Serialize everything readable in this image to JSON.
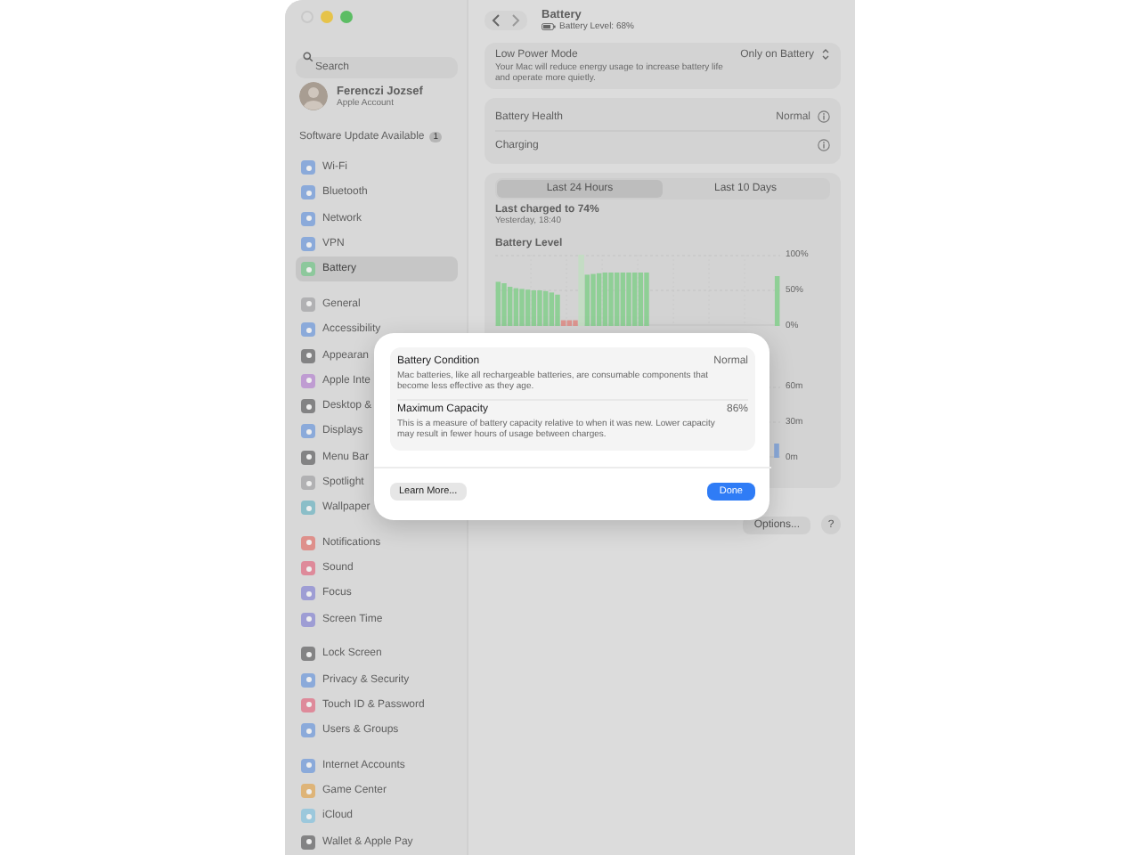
{
  "sidebar": {
    "search": {
      "placeholder": "Search"
    },
    "account": {
      "name": "Ferenczi Jozsef",
      "subtitle": "Apple Account"
    },
    "update": {
      "label": "Software Update Available",
      "badge": "1"
    },
    "groups": [
      {
        "items": [
          {
            "label": "Wi-Fi",
            "color": "#8baada",
            "selected": false
          },
          {
            "label": "Bluetooth",
            "color": "#8baada",
            "selected": false
          },
          {
            "label": "Network",
            "color": "#8baada",
            "selected": false
          },
          {
            "label": "VPN",
            "color": "#8baada",
            "selected": false
          },
          {
            "label": "Battery",
            "color": "#8dc89c",
            "selected": true
          }
        ]
      },
      {
        "items": [
          {
            "label": "General",
            "color": "#b1b1b3",
            "selected": false
          },
          {
            "label": "Accessibility",
            "color": "#8baada",
            "selected": false
          },
          {
            "label": "Appearan",
            "color": "#838384",
            "selected": false
          },
          {
            "label": "Apple Inte",
            "color": "#bf9cd2",
            "selected": false
          },
          {
            "label": "Desktop &",
            "color": "#838384",
            "selected": false
          },
          {
            "label": "Displays",
            "color": "#8baada",
            "selected": false
          },
          {
            "label": "Menu Bar",
            "color": "#838384",
            "selected": false
          },
          {
            "label": "Spotlight",
            "color": "#b1b1b3",
            "selected": false
          },
          {
            "label": "Wallpaper",
            "color": "#8bbec8",
            "selected": false
          }
        ]
      },
      {
        "items": [
          {
            "label": "Notifications",
            "color": "#de908b",
            "selected": false
          },
          {
            "label": "Sound",
            "color": "#de8a9a",
            "selected": false
          },
          {
            "label": "Focus",
            "color": "#9e9dd4",
            "selected": false
          },
          {
            "label": "Screen Time",
            "color": "#9e9dd4",
            "selected": false
          }
        ]
      },
      {
        "items": [
          {
            "label": "Lock Screen",
            "color": "#838384",
            "selected": false
          },
          {
            "label": "Privacy & Security",
            "color": "#8baada",
            "selected": false
          },
          {
            "label": "Touch ID & Password",
            "color": "#de8a9a",
            "selected": false
          },
          {
            "label": "Users & Groups",
            "color": "#8baada",
            "selected": false
          }
        ]
      },
      {
        "items": [
          {
            "label": "Internet Accounts",
            "color": "#8baada",
            "selected": false
          },
          {
            "label": "Game Center",
            "color": "#deb478",
            "selected": false
          },
          {
            "label": "iCloud",
            "color": "#9cc8dc",
            "selected": false
          },
          {
            "label": "Wallet & Apple Pay",
            "color": "#838384",
            "selected": false
          }
        ]
      }
    ]
  },
  "header": {
    "title": "Battery",
    "subtitle": "Battery Level: 68%"
  },
  "low_power": {
    "label": "Low Power Mode",
    "description": "Your Mac will reduce energy usage to increase battery life and operate more quietly.",
    "value": "Only on Battery"
  },
  "health": {
    "label": "Battery Health",
    "value": "Normal"
  },
  "charging": {
    "label": "Charging"
  },
  "segments": [
    {
      "label": "Last 24 Hours",
      "selected": true
    },
    {
      "label": "Last 10 Days",
      "selected": false
    }
  ],
  "last_charged": {
    "title": "Last charged to 74%",
    "time": "Yesterday, 18:40"
  },
  "battery_chart": {
    "title": "Battery Level",
    "y_labels": [
      "100%",
      "50%",
      "0%"
    ]
  },
  "usage_chart": {
    "y_labels": [
      "60m",
      "30m",
      "0m"
    ]
  },
  "dialog": {
    "rows": [
      {
        "title": "Battery Condition",
        "value": "Normal",
        "description": "Mac batteries, like all rechargeable batteries, are consumable components that become less effective as they age."
      },
      {
        "title": "Maximum Capacity",
        "value": "86%",
        "description": "This is a measure of battery capacity relative to when it was new. Lower capacity may result in fewer hours of usage between charges."
      }
    ],
    "secondary_button": "Learn More...",
    "primary_button": "Done"
  },
  "footer_buttons": [
    {
      "label": "Options...",
      "kind": "text"
    },
    {
      "label": "?",
      "kind": "help"
    }
  ]
}
